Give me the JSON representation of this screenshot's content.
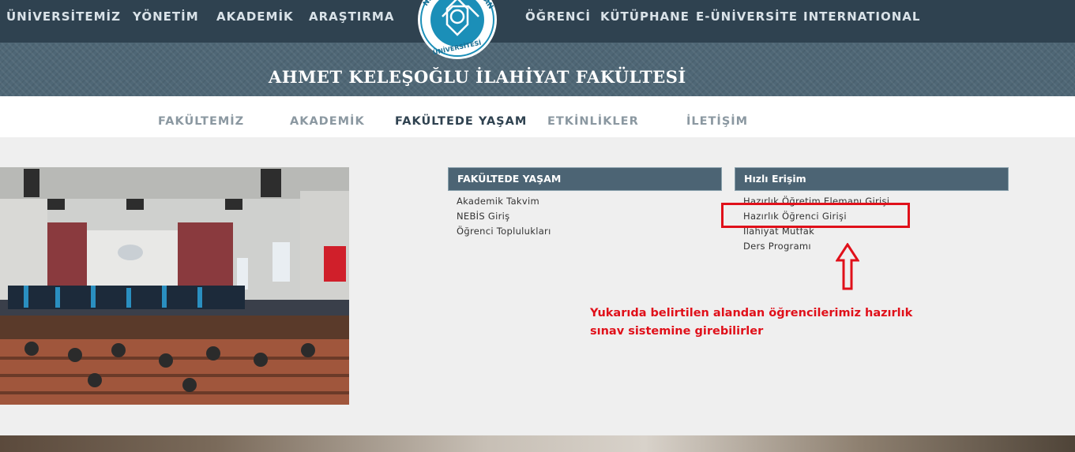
{
  "topnav": {
    "items": [
      "ÜNİVERSİTEMİZ",
      "YÖNETİM",
      "AKADEMİK",
      "ARAŞTIRMA",
      "ÖĞRENCİ",
      "KÜTÜPHANE",
      "E-ÜNİVERSİTE",
      "INTERNATIONAL"
    ]
  },
  "logo": {
    "ring_text_left": "NE",
    "ring_text_right": "AN",
    "ring_text_bottom": "ÜNİVERSİTESİ"
  },
  "header": {
    "title": "AHMET KELEŞOĞLU İLAHİYAT FAKÜLTESİ"
  },
  "subnav": {
    "items": [
      "FAKÜLTEMİZ",
      "AKADEMİK",
      "FAKÜLTEDE YAŞAM",
      "ETKİNLİKLER",
      "İLETİŞİM"
    ],
    "active": "FAKÜLTEDE YAŞAM"
  },
  "panels": {
    "left": {
      "title": "FAKÜLTEDE YAŞAM",
      "links": [
        "Akademik Takvim",
        "NEBİS Giriş",
        "Öğrenci Toplulukları"
      ]
    },
    "right": {
      "title": "Hızlı Erişim",
      "links": [
        "Hazırlık Öğretim Elemanı Girişi",
        "Hazırlık Öğrenci Girişi",
        "İlahiyat Mutfak",
        "Ders Programı"
      ]
    }
  },
  "annotation": {
    "line1": "Yukarıda belirtilen alandan öğrencilerimiz hazırlık",
    "line2": "sınav sistemine girebilirler",
    "color": "#e0101a"
  },
  "colors": {
    "topbar": "#2f4250",
    "banner": "#4f6776",
    "panel_header": "#4c6474",
    "page_bg": "#efefef"
  }
}
